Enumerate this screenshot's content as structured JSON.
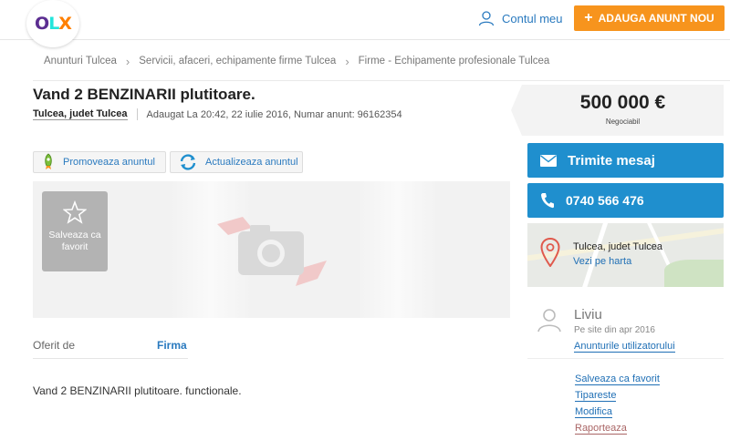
{
  "header": {
    "logo_o": "O",
    "logo_l": "L",
    "logo_x": "X",
    "account_label": "Contul meu",
    "add_button_label": "ADAUGA ANUNT NOU"
  },
  "breadcrumb": [
    "Anunturi Tulcea",
    "Servicii, afaceri, echipamente firme Tulcea",
    "Firme - Echipamente profesionale Tulcea"
  ],
  "ad": {
    "title": "Vand 2 BENZINARII plutitoare.",
    "location": "Tulcea, judet Tulcea",
    "added_info": "Adaugat La 20:42, 22 iulie 2016, Numar anunt: 96162354",
    "promote_label": "Promoveaza anuntul",
    "update_label": "Actualizeaza anuntul",
    "save_favorite_label": "Salveaza ca favorit",
    "offered_by_label": "Oferit de",
    "offered_by_value": "Firma",
    "description": "Vand 2 BENZINARII plutitoare. functionale."
  },
  "sidebar": {
    "price": "500 000 €",
    "negotiable": "Negociabil",
    "message_button": "Trimite mesaj",
    "phone_button": "0740 566 476",
    "map_location": "Tulcea, judet Tulcea",
    "map_link": "Vezi pe harta",
    "user_name": "Liviu",
    "user_since": "Pe site din apr 2016",
    "user_ads_link": "Anunturile utilizatorului",
    "links": [
      "Salveaza ca favorit",
      "Tipareste",
      "Modifica",
      "Raporteaza"
    ]
  },
  "colors": {
    "brand_orange": "#f7941d",
    "action_blue": "#1f8fce",
    "link_blue": "#2a7abf"
  }
}
